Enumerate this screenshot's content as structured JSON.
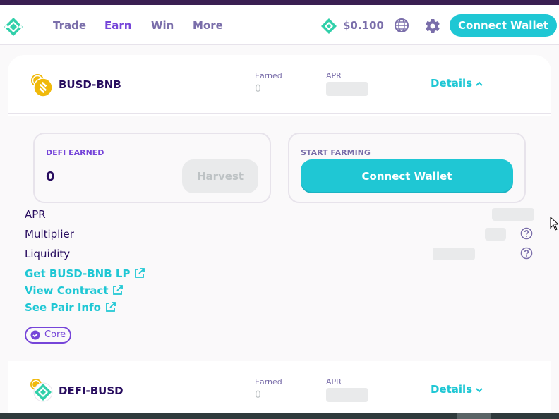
{
  "nav": {
    "links": [
      "Trade",
      "Earn",
      "Win",
      "More"
    ],
    "active": "Earn",
    "price": "$0.100",
    "connect_label": "Connect Wallet"
  },
  "farms": [
    {
      "pair": "BUSD-BNB",
      "earned_label": "Earned",
      "earned_value": "0",
      "apr_label": "APR",
      "details_label": "Details",
      "expanded": true,
      "defi_earned_title": "DEFI EARNED",
      "defi_earned_value": "0",
      "harvest_label": "Harvest",
      "start_farming_title": "START FARMING",
      "connect_label": "Connect Wallet",
      "info": {
        "apr": "APR",
        "multiplier": "Multiplier",
        "liquidity": "Liquidity"
      },
      "links": {
        "get_lp": "Get BUSD-BNB LP",
        "view_contract": "View Contract",
        "pair_info": "See Pair Info"
      },
      "tag": "Core"
    },
    {
      "pair": "DEFI-BUSD",
      "earned_label": "Earned",
      "earned_value": "0",
      "apr_label": "APR",
      "details_label": "Details",
      "expanded": false
    }
  ],
  "colors": {
    "primary": "#1fc7d4",
    "secondary": "#7645d9",
    "text": "#280d5f",
    "text_subtle": "#7a6eaa",
    "logo_green": "#31d0aa"
  }
}
